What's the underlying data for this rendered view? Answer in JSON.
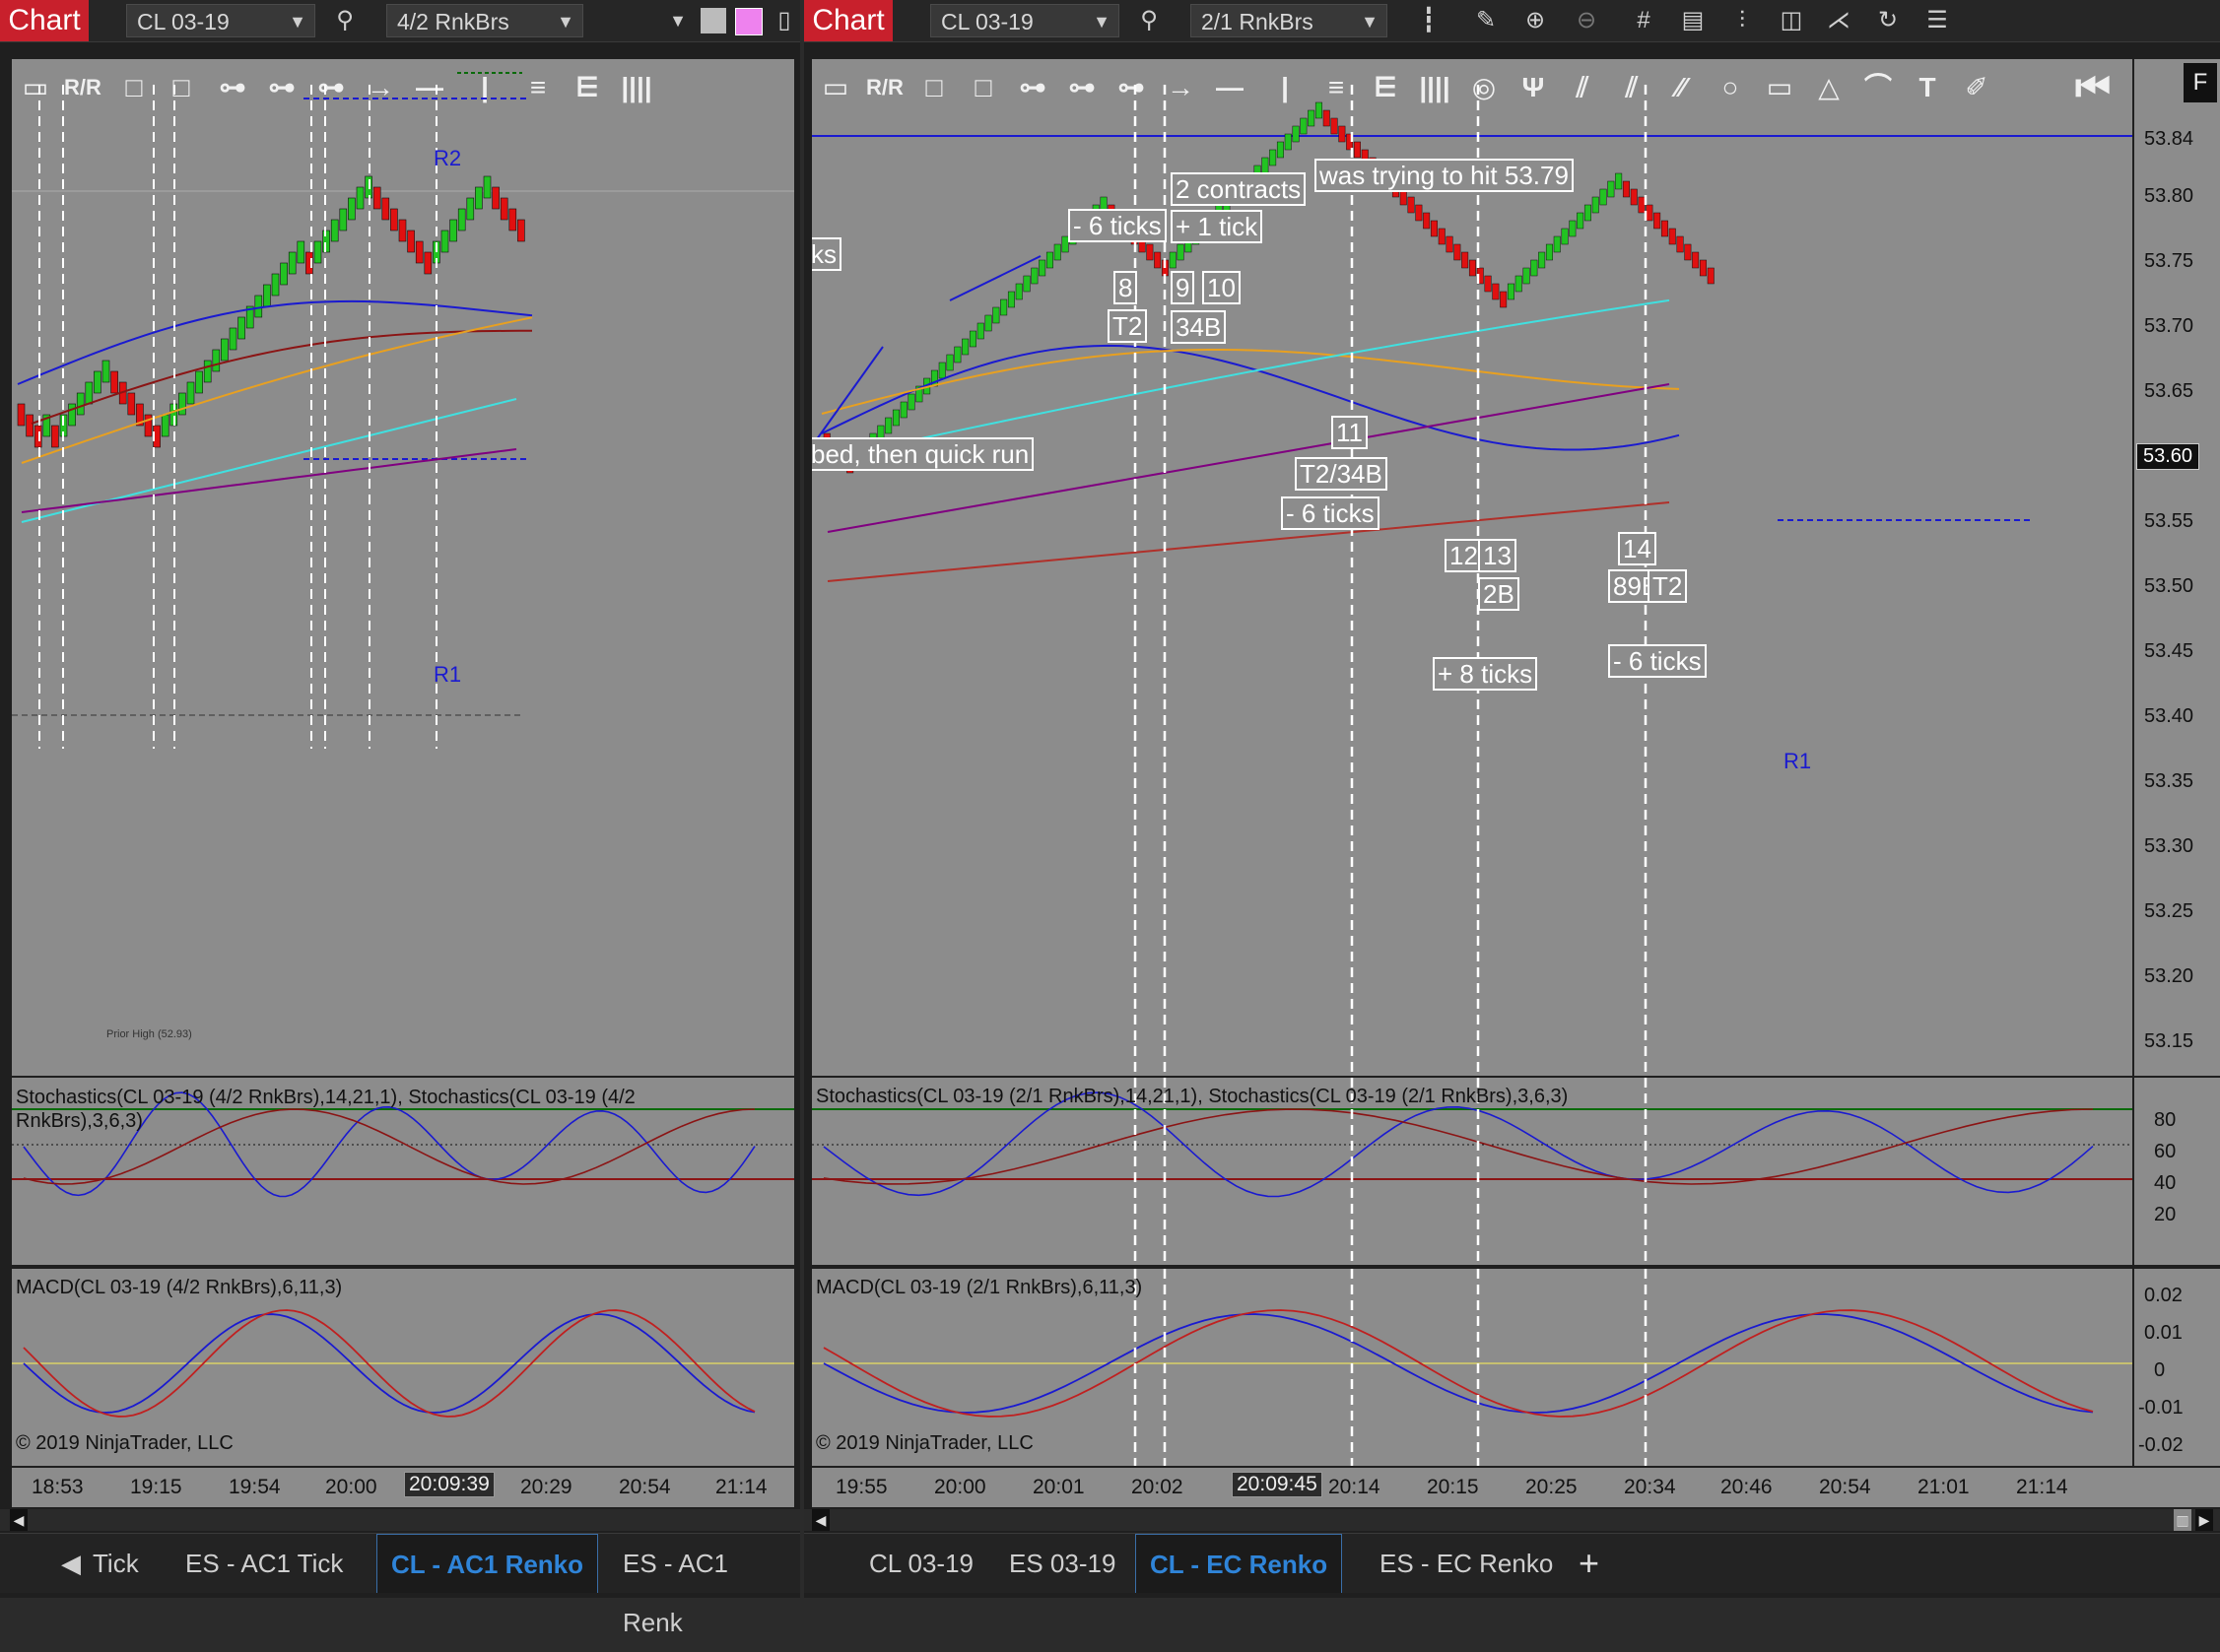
{
  "left": {
    "chart_label": "Chart",
    "instrument": "CL 03-19",
    "bar_type": "4/2 RnkBrs",
    "levels": {
      "r2": "R2",
      "r1": "R1",
      "prior_high": "Prior High (52.93)"
    },
    "stoch_title": "Stochastics(CL 03-19 (4/2 RnkBrs),14,21,1), Stochastics(CL 03-19 (4/2 RnkBrs),3,6,3)",
    "macd_title": "MACD(CL 03-19 (4/2 RnkBrs),6,11,3)",
    "copyright": "© 2019 NinjaTrader, LLC",
    "time_labels": [
      "18:53",
      "19:15",
      "19:54",
      "20:00",
      "20:09:39",
      "20:29",
      "20:54",
      "21:14"
    ],
    "tabs": [
      "Tick",
      "ES - AC1 Tick",
      "CL - AC1 Renko",
      "ES - AC1 Renk"
    ],
    "active_tab": "CL - AC1 Renko"
  },
  "right": {
    "chart_label": "Chart",
    "instrument": "CL 03-19",
    "bar_type": "2/1 RnkBrs",
    "f_button": "F",
    "notes": [
      "ks",
      "bed, then quick run",
      "- 6 ticks",
      "8",
      "T2",
      "2 contracts",
      "+ 1 tick",
      "9",
      "10",
      "34B",
      "was trying to hit 53.79",
      "11",
      "T2/34B",
      "- 6 ticks",
      "12",
      "13",
      "2B",
      "+ 8 ticks",
      "14",
      "89B",
      "T2",
      "- 6 ticks"
    ],
    "level_r1": "R1",
    "price_labels": [
      "53.84",
      "53.80",
      "53.75",
      "53.70",
      "53.65",
      "53.60",
      "53.55",
      "53.50",
      "53.45",
      "53.40",
      "53.35",
      "53.30",
      "53.25",
      "53.20",
      "53.15"
    ],
    "current_price": "53.60",
    "stoch_title": "Stochastics(CL 03-19 (2/1 RnkBrs),14,21,1), Stochastics(CL 03-19 (2/1 RnkBrs),3,6,3)",
    "stoch_levels": [
      "80",
      "60",
      "40",
      "20"
    ],
    "macd_title": "MACD(CL 03-19 (2/1 RnkBrs),6,11,3)",
    "macd_levels": [
      "0.02",
      "0.01",
      "0",
      "-0.01",
      "-0.02"
    ],
    "copyright": "© 2019 NinjaTrader, LLC",
    "time_labels": [
      "19:55",
      "20:00",
      "20:01",
      "20:02",
      "20:09:45",
      "20:14",
      "20:15",
      "20:25",
      "20:34",
      "20:46",
      "20:54",
      "21:01",
      "21:14"
    ],
    "tabs": [
      "CL 03-19",
      "ES 03-19",
      "CL - EC Renko",
      "ES - EC Renko"
    ],
    "active_tab": "CL - EC Renko",
    "add_tab": "+"
  },
  "colors": {
    "chart_label_bg": "#c8202c",
    "plot_bg": "#8c8c8c",
    "up_candle": "#22c322",
    "down_candle": "#e01010",
    "ema_fast": "#1a1ad0",
    "ema_mid": "#8b1414",
    "ema_orange": "#e8a020",
    "ema_cyan": "#40e0e0",
    "ema_purple": "#800080",
    "active_tab": "#2f84d8"
  }
}
